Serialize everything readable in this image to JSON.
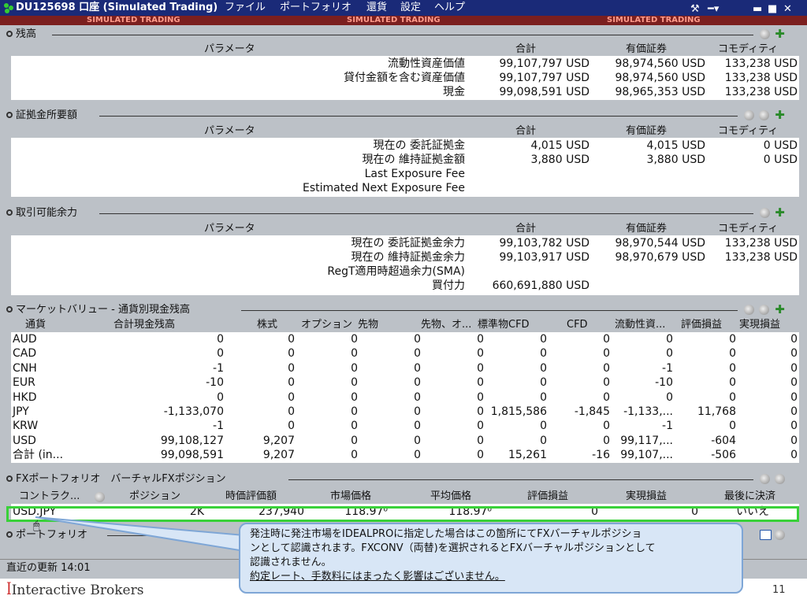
{
  "titlebar": {
    "account": "DU125698 口座 (Simulated Trading)",
    "menu": [
      "ファイル",
      "ポートフォリオ",
      "還貨",
      "設定",
      "ヘルプ"
    ]
  },
  "sim_banner": [
    "SIMULATED TRADING",
    "SIMULATED TRADING",
    "SIMULATED TRADING"
  ],
  "balance": {
    "title": "残高",
    "headers": [
      "パラメータ",
      "合計",
      "有価証券",
      "コモディティ"
    ],
    "rows": [
      {
        "label": "流動性資産価値",
        "total": "99,107,797 USD",
        "sec": "98,974,560 USD",
        "com": "133,238 USD"
      },
      {
        "label": "貸付金額を含む資産価値",
        "total": "99,107,797 USD",
        "sec": "98,974,560 USD",
        "com": "133,238 USD"
      },
      {
        "label": "現金",
        "total": "99,098,591 USD",
        "sec": "98,965,353 USD",
        "com": "133,238 USD"
      }
    ]
  },
  "margin": {
    "title": "証拠金所要額",
    "headers": [
      "パラメータ",
      "合計",
      "有価証券",
      "コモディティ"
    ],
    "rows": [
      {
        "label": "現在の 委託証拠金",
        "total": "4,015 USD",
        "sec": "4,015 USD",
        "com": "0 USD"
      },
      {
        "label": "現在の 維持証拠金額",
        "total": "3,880 USD",
        "sec": "3,880 USD",
        "com": "0 USD"
      },
      {
        "label": "Last Exposure Fee",
        "total": "",
        "sec": "",
        "com": ""
      },
      {
        "label": "Estimated Next Exposure Fee",
        "total": "",
        "sec": "",
        "com": ""
      }
    ]
  },
  "available": {
    "title": "取引可能余力",
    "headers": [
      "パラメータ",
      "合計",
      "有価証券",
      "コモディティ"
    ],
    "rows": [
      {
        "label": "現在の 委託証拠金余力",
        "total": "99,103,782 USD",
        "sec": "98,970,544 USD",
        "com": "133,238 USD"
      },
      {
        "label": "現在の 維持証拠金余力",
        "total": "99,103,917 USD",
        "sec": "98,970,679 USD",
        "com": "133,238 USD"
      },
      {
        "label": "RegT適用時超過余力(SMA)",
        "total": "",
        "sec": "",
        "com": ""
      },
      {
        "label": "買付力",
        "total": "660,691,880 USD",
        "sec": "",
        "com": ""
      }
    ]
  },
  "market": {
    "title": "マーケットバリュー - 通貨別現金残高",
    "headers": [
      "通貨",
      "合計現金残高",
      "株式",
      "オプション",
      "先物",
      "先物、オ...",
      "標準物CFD",
      "CFD",
      "流動性資...",
      "評価損益",
      "実現損益"
    ],
    "rows": [
      [
        "AUD",
        "0",
        "0",
        "0",
        "0",
        "0",
        "0",
        "0",
        "0",
        "0",
        "0"
      ],
      [
        "CAD",
        "0",
        "0",
        "0",
        "0",
        "0",
        "0",
        "0",
        "0",
        "0",
        "0"
      ],
      [
        "CNH",
        "-1",
        "0",
        "0",
        "0",
        "0",
        "0",
        "0",
        "-1",
        "0",
        "0"
      ],
      [
        "EUR",
        "-10",
        "0",
        "0",
        "0",
        "0",
        "0",
        "0",
        "-10",
        "0",
        "0"
      ],
      [
        "HKD",
        "0",
        "0",
        "0",
        "0",
        "0",
        "0",
        "0",
        "0",
        "0",
        "0"
      ],
      [
        "JPY",
        "-1,133,070",
        "0",
        "0",
        "0",
        "0",
        "1,815,586",
        "-1,845",
        "-1,133,...",
        "11,768",
        "0"
      ],
      [
        "KRW",
        "-1",
        "0",
        "0",
        "0",
        "0",
        "0",
        "0",
        "-1",
        "0",
        "0"
      ],
      [
        "USD",
        "99,108,127",
        "9,207",
        "0",
        "0",
        "0",
        "0",
        "0",
        "99,117,...",
        "-604",
        "0"
      ],
      [
        "合計 (in...",
        "99,098,591",
        "9,207",
        "0",
        "0",
        "0",
        "15,261",
        "-16",
        "99,107,...",
        "-506",
        "0"
      ]
    ]
  },
  "fx": {
    "title": "FXポートフォリオ　バーチャルFXポジション",
    "headers": [
      "コントラク...",
      "ポジション",
      "時価評価額",
      "市場価格",
      "平均価格",
      "評価損益",
      "実現損益",
      "最後に決済"
    ],
    "row": [
      "USD.JPY",
      "2K",
      "237,940",
      "118.97⁰",
      "118.97⁰",
      "0",
      "0",
      "いいえ"
    ]
  },
  "portfolio": {
    "title": "ポートフォリオ"
  },
  "status": {
    "text": "直近の更新 14:01"
  },
  "callout": {
    "line1": "発注時に発注市場をIDEALPROに指定した場合はこの箇所にてFXバーチャルポジショ",
    "line2": "ンとして認識されます。FXCONV（両替)を選択されるとFXバーチャルポジションとして",
    "line3": "認識されません。",
    "line4": "約定レート、手数料にはまったく影響はございません。"
  },
  "footer": {
    "brand": "Interactive Brokers",
    "page": "11"
  }
}
